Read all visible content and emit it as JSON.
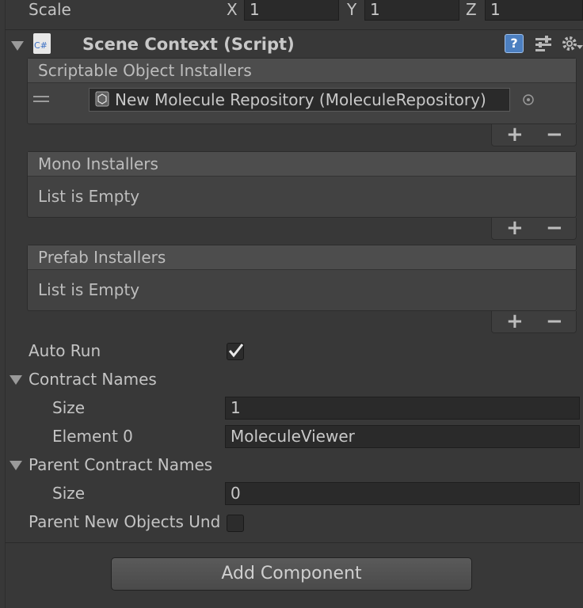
{
  "transform": {
    "scale_label": "Scale",
    "x_label": "X",
    "x_value": "1",
    "y_label": "Y",
    "y_value": "1",
    "z_label": "Z",
    "z_value": "1"
  },
  "component": {
    "title": "Scene Context (Script)",
    "icon_text": "C#"
  },
  "scriptable_installers": {
    "header": "Scriptable Object Installers",
    "items": [
      {
        "value": "New Molecule Repository (MoleculeRepository)"
      }
    ]
  },
  "mono_installers": {
    "header": "Mono Installers",
    "empty_text": "List is Empty"
  },
  "prefab_installers": {
    "header": "Prefab Installers",
    "empty_text": "List is Empty"
  },
  "list_controls": {
    "add": "+",
    "remove": "−"
  },
  "auto_run": {
    "label": "Auto Run",
    "checked": true
  },
  "contract_names": {
    "label": "Contract Names",
    "size_label": "Size",
    "size_value": "1",
    "element0_label": "Element 0",
    "element0_value": "MoleculeViewer"
  },
  "parent_contract_names": {
    "label": "Parent Contract Names",
    "size_label": "Size",
    "size_value": "0"
  },
  "parent_new_objects": {
    "label": "Parent New Objects Und",
    "checked": false
  },
  "add_component": {
    "label": "Add Component"
  }
}
